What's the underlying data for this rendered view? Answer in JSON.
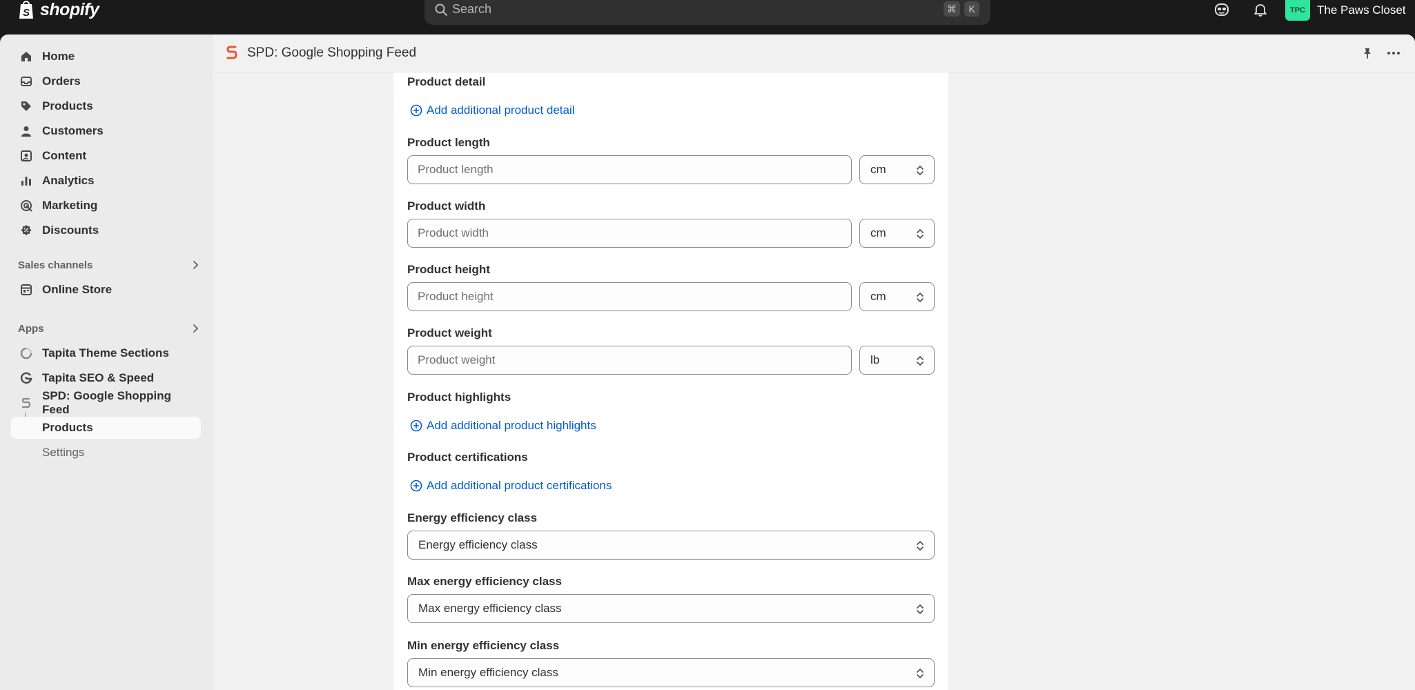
{
  "topbar": {
    "brand": "shopify",
    "search_placeholder": "Search",
    "shortcut_cmd": "⌘",
    "shortcut_key": "K",
    "store_initials": "TPC",
    "store_name": "The Paws Closet"
  },
  "sidebar": {
    "items": [
      {
        "label": "Home",
        "icon": "home-icon"
      },
      {
        "label": "Orders",
        "icon": "orders-icon"
      },
      {
        "label": "Products",
        "icon": "tag-icon"
      },
      {
        "label": "Customers",
        "icon": "person-icon"
      },
      {
        "label": "Content",
        "icon": "image-icon"
      },
      {
        "label": "Analytics",
        "icon": "bar-chart-icon"
      },
      {
        "label": "Marketing",
        "icon": "target-icon"
      },
      {
        "label": "Discounts",
        "icon": "discount-icon"
      }
    ],
    "sales_channels_label": "Sales channels",
    "online_store_label": "Online Store",
    "apps_label": "Apps",
    "apps": [
      {
        "label": "Tapita Theme Sections"
      },
      {
        "label": "Tapita SEO & Speed"
      },
      {
        "label": "SPD: Google Shopping Feed"
      }
    ],
    "app_subitems": [
      {
        "label": "Products",
        "active": true
      },
      {
        "label": "Settings",
        "active": false
      }
    ]
  },
  "app_header": {
    "title": "SPD: Google Shopping Feed"
  },
  "form": {
    "product_detail_label": "Product detail",
    "add_detail_link": "Add additional product detail",
    "length_label": "Product length",
    "length_placeholder": "Product length",
    "length_unit": "cm",
    "width_label": "Product width",
    "width_placeholder": "Product width",
    "width_unit": "cm",
    "height_label": "Product height",
    "height_placeholder": "Product height",
    "height_unit": "cm",
    "weight_label": "Product weight",
    "weight_placeholder": "Product weight",
    "weight_unit": "lb",
    "highlights_label": "Product highlights",
    "add_highlights_link": "Add additional product highlights",
    "certifications_label": "Product certifications",
    "add_certifications_link": "Add additional product certifications",
    "energy_label": "Energy efficiency class",
    "energy_value": "Energy efficiency class",
    "max_energy_label": "Max energy efficiency class",
    "max_energy_value": "Max energy efficiency class",
    "min_energy_label": "Min energy efficiency class",
    "min_energy_value": "Min energy efficiency class"
  },
  "colors": {
    "accent_link": "#005bd3",
    "topbar_bg": "#1a1a1a",
    "store_avatar": "#2ee59d",
    "app_logo": "#e8583a"
  }
}
